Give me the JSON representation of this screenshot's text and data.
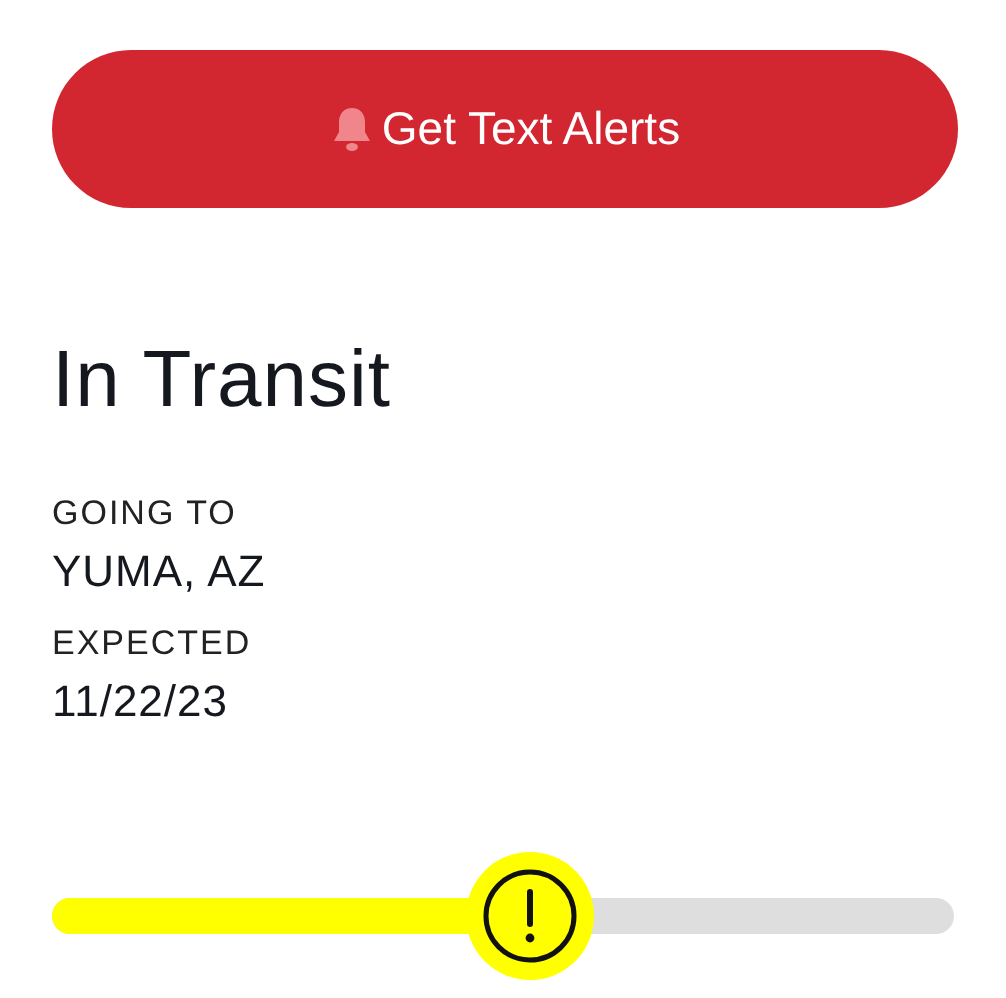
{
  "alert_button": {
    "label": "Get Text Alerts"
  },
  "status": "In Transit",
  "details": [
    {
      "label": "GOING TO",
      "value": "YUMA, AZ"
    },
    {
      "label": "EXPECTED",
      "value": "11/22/23"
    }
  ],
  "progress": {
    "level": 0.53
  }
}
